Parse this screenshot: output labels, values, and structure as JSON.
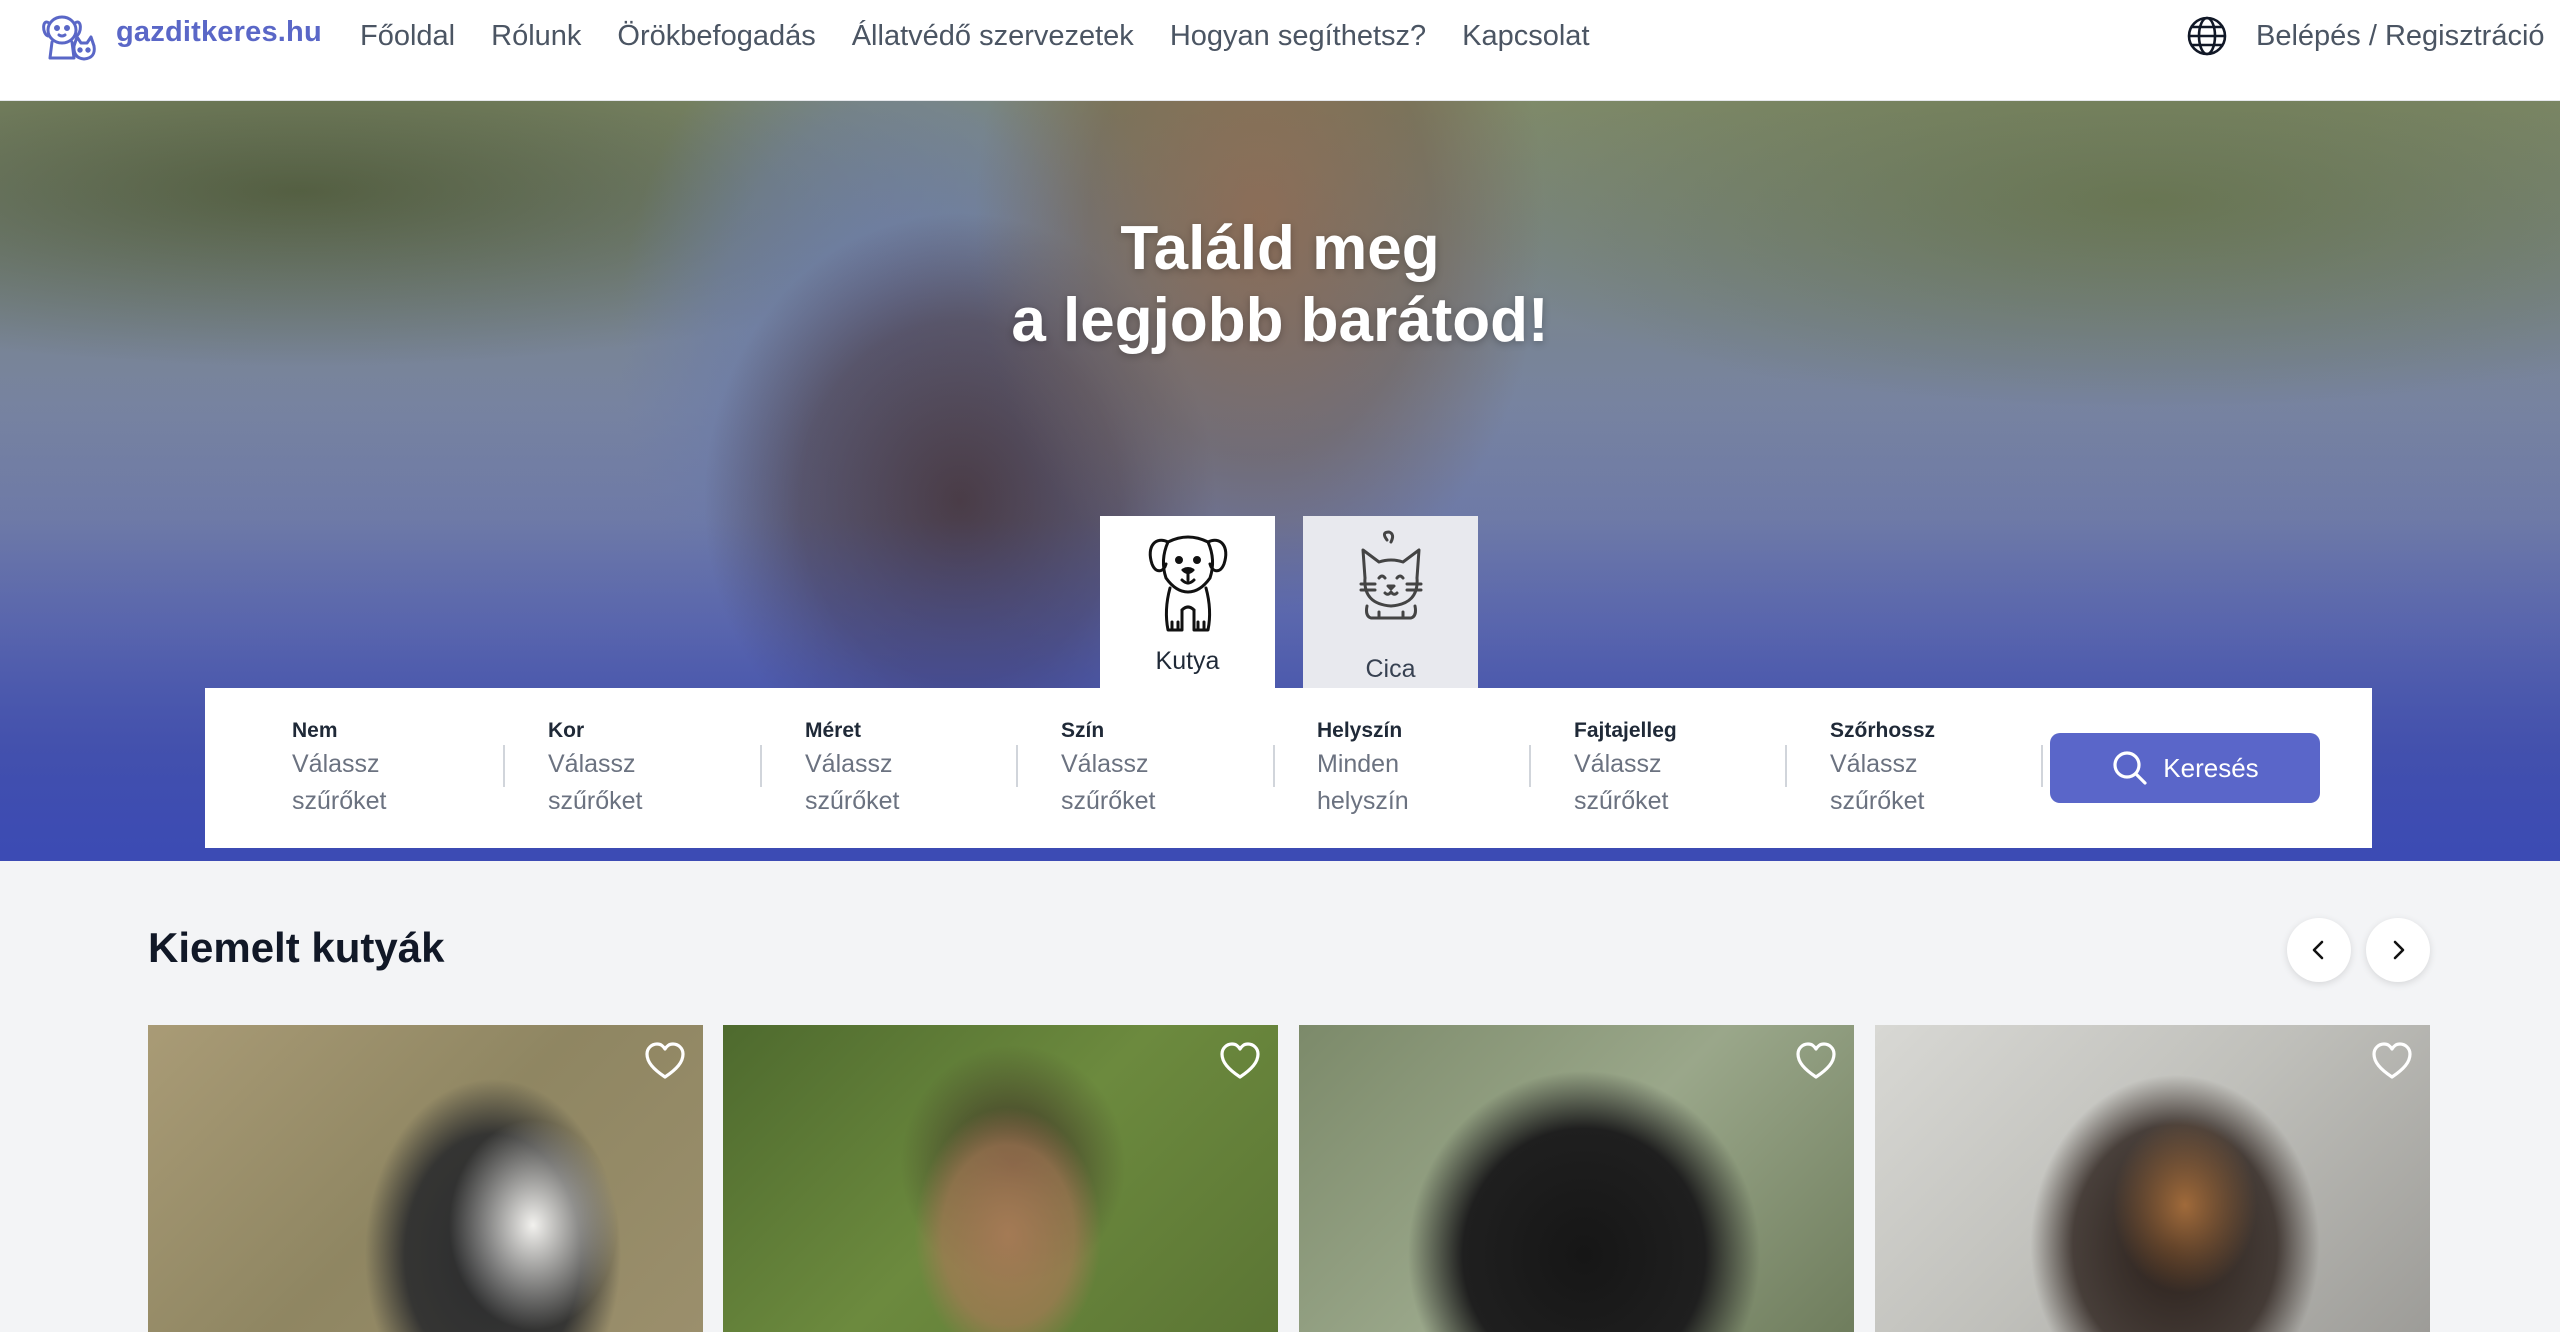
{
  "header": {
    "logo_text": "gazditkeres.hu",
    "nav": [
      {
        "label": "Főoldal"
      },
      {
        "label": "Rólunk"
      },
      {
        "label": "Örökbefogadás"
      },
      {
        "label": "Állatvédő szervezetek"
      },
      {
        "label": "Hogyan segíthetsz?"
      },
      {
        "label": "Kapcsolat"
      }
    ],
    "language_icon": "globe-icon",
    "login_label": "Belépés / Regisztráció"
  },
  "hero": {
    "title_line1": "Találd meg",
    "title_line2": "a legjobb barátod!",
    "tabs": [
      {
        "label": "Kutya",
        "icon": "dog-icon",
        "selected": true
      },
      {
        "label": "Cica",
        "icon": "cat-icon",
        "selected": false
      }
    ]
  },
  "filters": [
    {
      "title": "Nem",
      "value": "Válassz szűrőket"
    },
    {
      "title": "Kor",
      "value": "Válassz szűrőket"
    },
    {
      "title": "Méret",
      "value": "Válassz szűrőket"
    },
    {
      "title": "Szín",
      "value": "Válassz szűrőket"
    },
    {
      "title": "Helyszín",
      "value": "Minden helyszín"
    },
    {
      "title": "Fajtajelleg",
      "value": "Válassz szűrőket"
    },
    {
      "title": "Szőrhossz",
      "value": "Válassz szűrőket"
    }
  ],
  "search": {
    "label": "Keresés",
    "icon": "search-icon"
  },
  "featured": {
    "title": "Kiemelt kutyák",
    "cards": [
      {
        "photo": "husky-photo",
        "favorite_icon": "heart-icon"
      },
      {
        "photo": "brown-dog-photo",
        "favorite_icon": "heart-icon"
      },
      {
        "photo": "black-dog-photo",
        "favorite_icon": "heart-icon"
      },
      {
        "photo": "tan-black-dog-photo",
        "favorite_icon": "heart-icon"
      }
    ]
  },
  "colors": {
    "brand": "#5a66c9",
    "hero_bottom": "#3c4bb4",
    "background": "#f3f4f6"
  }
}
